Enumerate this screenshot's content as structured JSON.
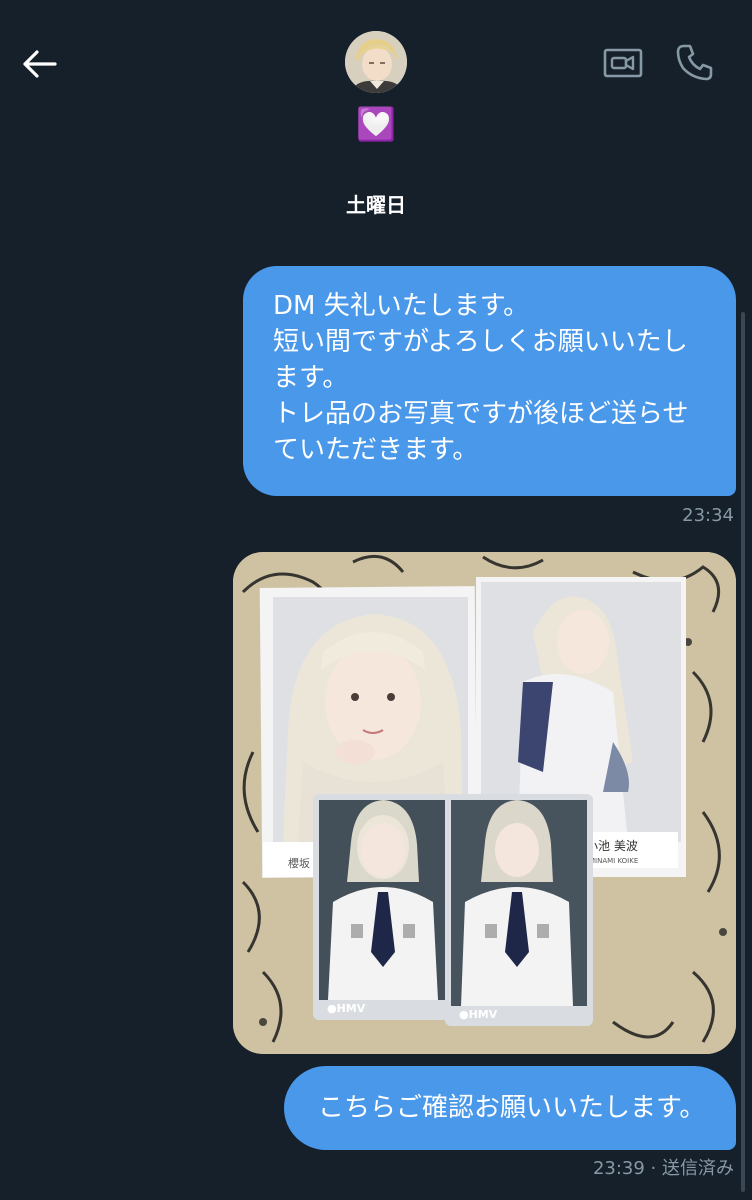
{
  "header": {
    "back_icon": "arrow-left-icon",
    "display_name": "💟",
    "video_icon": "video-call-icon",
    "call_icon": "phone-icon"
  },
  "date_separator": "土曜日",
  "messages": [
    {
      "type": "text",
      "lines": [
        "DM 失礼いたします。",
        "短い間ですがよろしくお願いいたし",
        "ます。",
        "トレ品のお写真ですが後ほど送らせ",
        "ていただきます。"
      ],
      "timestamp": "23:34"
    },
    {
      "type": "image",
      "photo_labels": {
        "name_card": "小池 美波",
        "name_romaji": "MINAMI KOIKE",
        "left_card_label": "櫻坂",
        "brand": "HMV"
      }
    },
    {
      "type": "text",
      "text": "こちらご確認お願いいたします。",
      "timestamp": "23:39 · 送信済み"
    }
  ],
  "colors": {
    "background": "#15202b",
    "bubble": "#4a98ea",
    "timestamp": "#8899a6"
  }
}
